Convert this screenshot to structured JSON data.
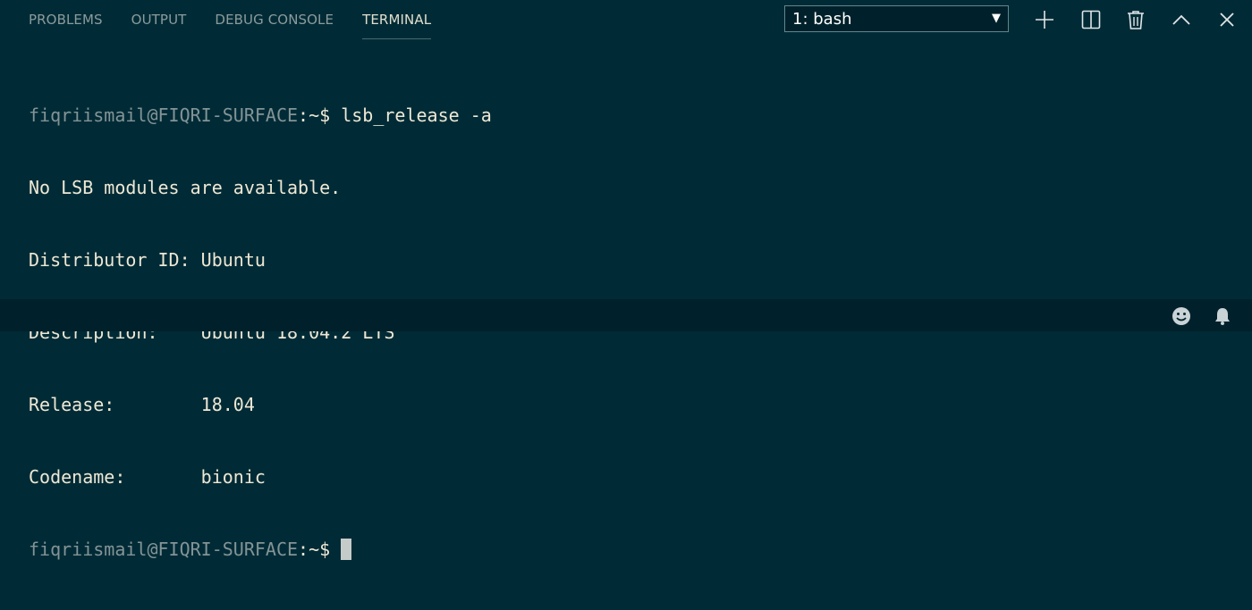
{
  "panel": {
    "tabs": [
      {
        "label": "PROBLEMS",
        "active": false
      },
      {
        "label": "OUTPUT",
        "active": false
      },
      {
        "label": "DEBUG CONSOLE",
        "active": false
      },
      {
        "label": "TERMINAL",
        "active": true
      }
    ],
    "terminal_select": {
      "value": "1: bash"
    },
    "actions": [
      {
        "icon": "plus-icon",
        "label": "New Terminal"
      },
      {
        "icon": "split-icon",
        "label": "Split Terminal"
      },
      {
        "icon": "trash-icon",
        "label": "Kill Terminal"
      },
      {
        "icon": "chevron-up-icon",
        "label": "Maximize Panel"
      },
      {
        "icon": "close-icon",
        "label": "Close Panel"
      }
    ]
  },
  "terminal": {
    "prompt_user": "fiqriismail@FIQRI-SURFACE",
    "prompt_suffix": ":~$",
    "command": " lsb_release -a",
    "output": [
      "No LSB modules are available.",
      "Distributor ID: Ubuntu",
      "Description:    Ubuntu 18.04.2 LTS",
      "Release:        18.04",
      "Codename:       bionic"
    ]
  },
  "status_bar": {
    "icons": [
      "smiley-icon",
      "bell-icon"
    ]
  },
  "colors": {
    "background": "#002b36",
    "status_bar": "#00212b",
    "text": "#eee8d5",
    "prompt": "#839496"
  }
}
